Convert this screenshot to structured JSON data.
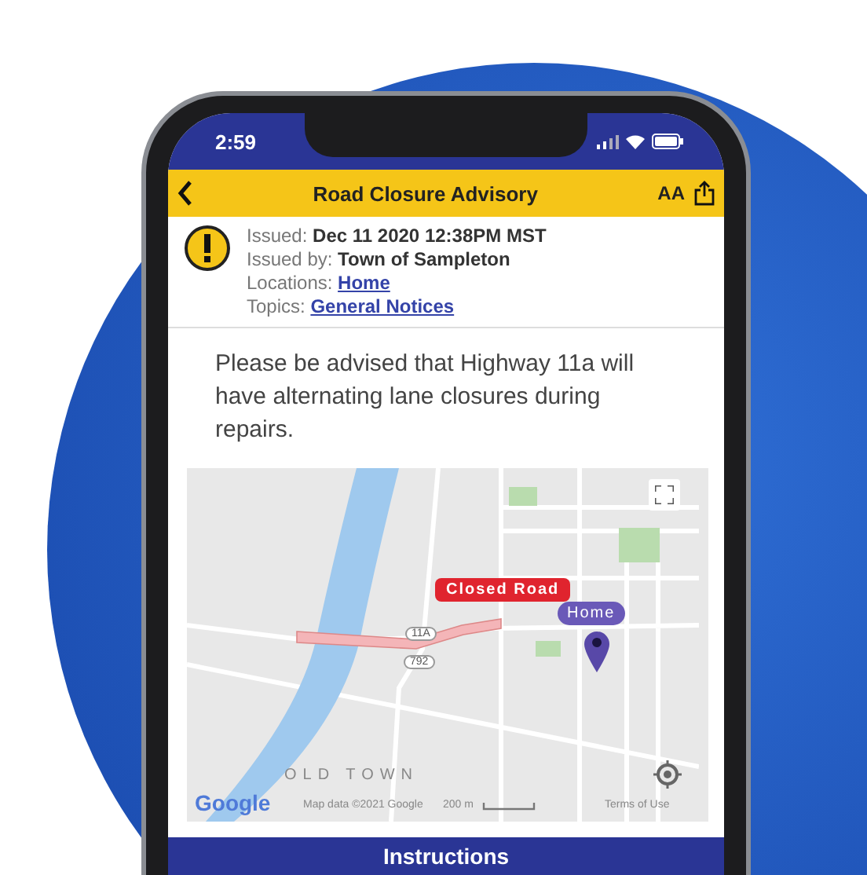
{
  "status_bar": {
    "time": "2:59"
  },
  "header": {
    "title": "Road Closure Advisory",
    "text_size": "AA"
  },
  "info": [
    {
      "label": "Issued:",
      "value": "Dec 11 2020 12:38PM MST",
      "kind": "text"
    },
    {
      "label": "Issued by:",
      "value": "Town of Sampleton",
      "kind": "text"
    },
    {
      "label": "Locations:",
      "value": "Home",
      "kind": "link"
    },
    {
      "label": "Topics:",
      "value": "General Notices",
      "kind": "link"
    }
  ],
  "message": "Please be advised that Highway 11a will have alternating lane closures during repairs.",
  "map": {
    "closure_label": "Closed Road",
    "pin_label": "Home",
    "shields": [
      "11A",
      "792"
    ],
    "area_label": "OLD TOWN",
    "logo": "Google",
    "attribution": "Map data ©2021 Google",
    "scale": "200 m",
    "terms": "Terms of Use"
  },
  "section": {
    "title": "Instructions"
  }
}
